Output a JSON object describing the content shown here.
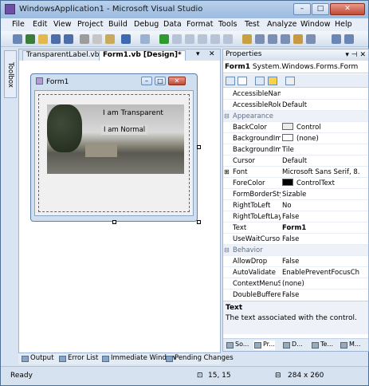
{
  "window": {
    "title": "WindowsApplication1 - Microsoft Visual Studio"
  },
  "menu": [
    "File",
    "Edit",
    "View",
    "Project",
    "Build",
    "Debug",
    "Data",
    "Format",
    "Tools",
    "Test",
    "Analyze",
    "Window",
    "Help"
  ],
  "toolbox": {
    "label": "Toolbox"
  },
  "tabs": [
    {
      "label": "TransparentLabel.vb"
    },
    {
      "label": "Form1.vb [Design]*"
    }
  ],
  "form": {
    "title": "Form1",
    "label_transparent": "I am Transparent",
    "label_normal": "I am Normal"
  },
  "bottom_tabs": [
    "Output",
    "Error List",
    "Immediate Window",
    "Pending Changes"
  ],
  "properties": {
    "header": "Properties",
    "object": "Form1",
    "object_type": "System.Windows.Forms.Form",
    "rows": [
      {
        "name": "AccessibleNam",
        "value": ""
      },
      {
        "name": "AccessibleRole",
        "value": "Default"
      },
      {
        "category": "Appearance"
      },
      {
        "name": "BackColor",
        "value": "Control",
        "swatch": "#ececec"
      },
      {
        "name": "BackgroundIm",
        "value": "(none)",
        "swatch": "#ffffff"
      },
      {
        "name": "BackgroundIm",
        "value": "Tile"
      },
      {
        "name": "Cursor",
        "value": "Default"
      },
      {
        "name": "Font",
        "value": "Microsoft Sans Serif, 8.",
        "expand": "+"
      },
      {
        "name": "ForeColor",
        "value": "ControlText",
        "swatch": "#000000"
      },
      {
        "name": "FormBorderSty",
        "value": "Sizable"
      },
      {
        "name": "RightToLeft",
        "value": "No"
      },
      {
        "name": "RightToLeftLay",
        "value": "False"
      },
      {
        "name": "Text",
        "value": "Form1",
        "bold": true
      },
      {
        "name": "UseWaitCursor",
        "value": "False"
      },
      {
        "category": "Behavior"
      },
      {
        "name": "AllowDrop",
        "value": "False"
      },
      {
        "name": "AutoValidate",
        "value": "EnablePreventFocusCh"
      },
      {
        "name": "ContextMenuSt",
        "value": "(none)"
      },
      {
        "name": "DoubleBuffere",
        "value": "False"
      }
    ],
    "desc_title": "Text",
    "desc_body": "The text associated with the control.",
    "bottom_tabs": [
      "So...",
      "Pr...",
      "D...",
      "Te...",
      "M..."
    ]
  },
  "status": {
    "ready": "Ready",
    "position": "15, 15",
    "size": "284 x 260"
  }
}
